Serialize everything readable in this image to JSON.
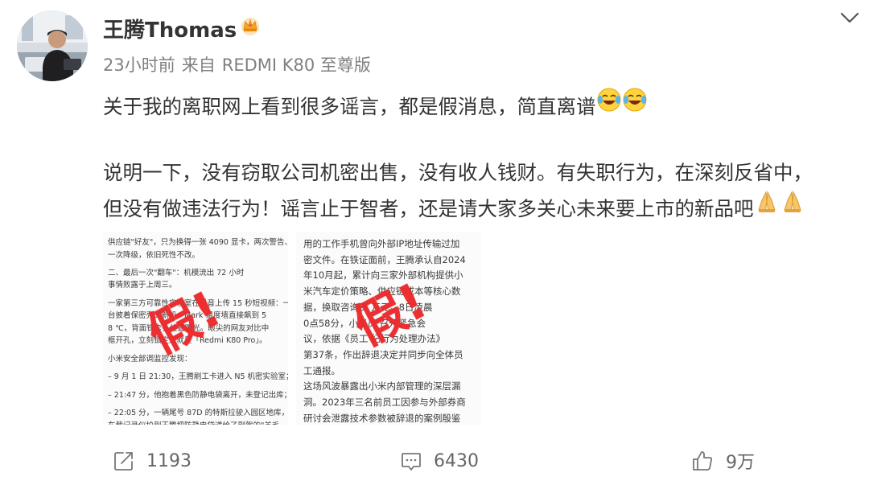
{
  "post": {
    "author": "王腾Thomas",
    "time": "23小时前",
    "source_prefix": "来自",
    "source_device": "REDMI K80 至尊版",
    "line1": "关于我的离职网上看到很多谣言，都是假消息，简直离谱",
    "line2": "说明一下，没有窃取公司机密出售，没有收人钱财。有失职行为，在深刻反省中，",
    "line3": "但没有做违法行为！谣言止于智者，还是请大家多关心未来要上市的新品吧",
    "emoji_laugh": "laugh-cry-emoji",
    "emoji_pray": "pray-hands-emoji"
  },
  "images": {
    "left_lines": [
      "供应链\"好友\"，只为换得一张 4090 显卡，两次警告、",
      "一次降级，依旧死性不改。",
      "",
      "二、最后一次\"翻车\"：机模流出 72 小时",
      "事情败露于上周三。",
      "",
      "一家第三方可靠性实验室在抖音上传 15 秒短视频：一",
      "台披着保密壳的新机，Mark 温度墙直接飙到 5",
      "8 ℃，背面铢卡孔位置曝光。眼尖的网友对比中",
      "框开孔，立刻锁定这就是「Redmi K80 Pro」。",
      "",
      "小米安全部调监控发现：",
      "",
      "– 9 月 1 日 21:30，王腾刷工卡进入 N5 机密实验室；",
      "",
      "– 21:47 分，他抱着黑色防静电袋离开，未登记出库；",
      "",
      "– 22:05 分，一辆尾号 87D 的特斯拉驶入园区地库，",
      "车载记录仪拍到王腾把防静电袋递给了副驾的\"羊毛"
    ],
    "right_lines": [
      "用的工作手机曾向外部IP地址传输过加",
      "密文件。在铁证面前，王腾承认自2024",
      "年10月起，累计向三家外部机构提供小",
      "米汽车定价策略、供应链成本等核心数",
      "据，换取咨询费 万元。8日凌晨",
      "0点58分，小米员 召开紧急会",
      "议，依据《员工 纪行为处理办法》",
      "第37条，作出辞退决定并同步向全体员",
      "工通报。",
      "这场风波暴露出小米内部管理的深层漏",
      "洞。2023年三名前员工因参与外部券商",
      "研讨会泄露技术参数被辞退的案例殷鉴"
    ],
    "stamp_text": "假!"
  },
  "actions": {
    "repost_count": "1193",
    "comment_count": "6430",
    "like_count": "9万"
  },
  "colors": {
    "stamp": "#ee2a2d",
    "text": "#333333",
    "meta": "#808080",
    "badge": "#f5a623"
  }
}
